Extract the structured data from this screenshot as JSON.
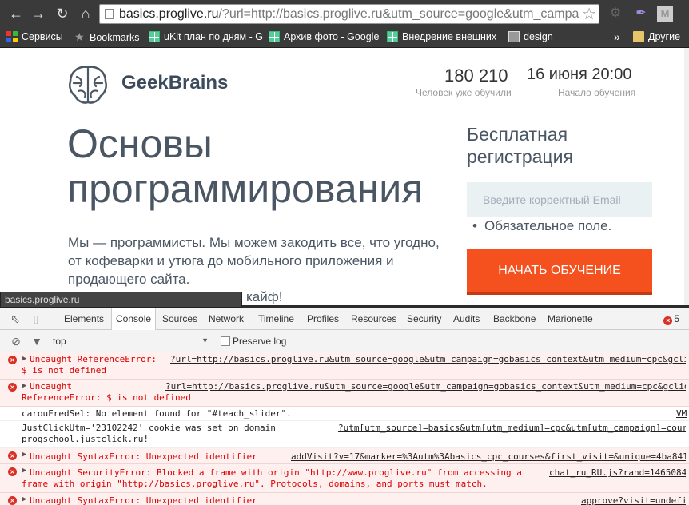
{
  "browser": {
    "url_host": "basics.proglive.ru",
    "url_rest": "/?url=http://basics.proglive.ru&utm_source=google&utm_campa",
    "bookmarks": [
      {
        "label": "Сервисы",
        "icon": "apps-icon"
      },
      {
        "label": "Bookmarks",
        "icon": "bookmarks-icon"
      },
      {
        "label": "uKit план по дням - G",
        "icon": "sheet-icon"
      },
      {
        "label": "Архив фото - Google",
        "icon": "sheet-icon"
      },
      {
        "label": "Внедрение внешних",
        "icon": "sheet-icon"
      },
      {
        "label": "design",
        "icon": "folder-icon"
      }
    ],
    "more": "»",
    "other_bookmarks": "Другие"
  },
  "site": {
    "logo_text": "GeekBrains",
    "stats": [
      {
        "value": "180 210",
        "caption": "Человек уже обучили"
      },
      {
        "value": "16 июня 20:00",
        "caption": "Начало обучения"
      }
    ],
    "hero_title": "Основы программирования",
    "hero_text": "Мы — программисты. Мы можем закодить все, что угодно, от кофеварки и утюга до мобильного приложения и продающего сайта.",
    "hero_tail": "кайф!",
    "reg_title": "Бесплатная регистрация",
    "email_placeholder": "Введите корректный Email",
    "required_note": "Обязательное поле.",
    "cta_label": "НАЧАТЬ ОБУЧЕНИЕ",
    "status_url": "basics.proglive.ru"
  },
  "devtools": {
    "tabs": [
      "Elements",
      "Console",
      "Sources",
      "Network",
      "Timeline",
      "Profiles",
      "Resources",
      "Security",
      "Audits",
      "Backbone",
      "Marionette"
    ],
    "active_tab": "Console",
    "error_count": "5",
    "context": "top",
    "preserve_log": "Preserve log",
    "messages": [
      {
        "level": "error",
        "text": "Uncaught ReferenceError:",
        "text2": "$ is not defined",
        "src": "?url=http://basics.proglive.ru&utm_source=google&utm_campaign=gobasics_context&utm_medium=cpc&gclid"
      },
      {
        "level": "error",
        "text": "Uncaught",
        "text2": "ReferenceError: $ is not defined",
        "src": "?url=http://basics.proglive.ru&utm_source=google&utm_campaign=gobasics_context&utm_medium=cpc&gclid"
      },
      {
        "level": "log",
        "text": "carouFredSel: No element found for \"#teach_slider\".",
        "src": "VM"
      },
      {
        "level": "log",
        "text": "JustClickUtm='23102242' cookie was set on domain",
        "text2": "progschool.justclick.ru!",
        "src": "?utm[utm_source]=basics&utm[utm_medium]=cpc&utm[utm_campaign]=cour"
      },
      {
        "level": "error",
        "text": "Uncaught SyntaxError: Unexpected identifier",
        "src": "addVisit?v=17&marker=%3Autm%3Abasics_cpc_courses&first_visit=&unique=4ba841"
      },
      {
        "level": "error",
        "text": "Uncaught SecurityError: Blocked a frame with origin \"http://www.proglive.ru\" from accessing a",
        "text2": "frame with origin \"http://basics.proglive.ru\". Protocols, domains, and ports must match.",
        "src": "chat_ru_RU.js?rand=1465084"
      },
      {
        "level": "error",
        "text": "Uncaught SyntaxError: Unexpected identifier",
        "src": "approve?visit=undefi"
      }
    ]
  }
}
